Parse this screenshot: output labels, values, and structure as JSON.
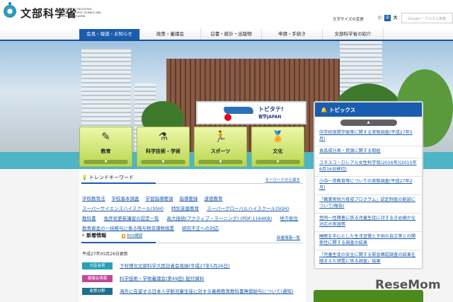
{
  "header": {
    "logo_text": "文部科学省",
    "logo_en": "MINISTRY OF EDUCATION, CULTURE, SPORTS, SCIENCE AND TECHNOLOGY-JAPAN",
    "font_size_label": "文字サイズの変更",
    "font_sizes": [
      "小",
      "中",
      "大"
    ],
    "search_placeholder": "Google™ カスタム検索"
  },
  "nav": [
    "会見・報道・お知らせ",
    "政策・審議会",
    "白書・統計・出版物",
    "申請・手続き",
    "文部科学省の紹介"
  ],
  "banner": {
    "title": "トビタテ!",
    "subtitle": "留学JAPAN"
  },
  "tiles": [
    {
      "label": "教育",
      "icon": "✎"
    },
    {
      "label": "科学技術・学術",
      "icon": "⚗"
    },
    {
      "label": "スポーツ",
      "icon": "🏃"
    },
    {
      "label": "文化",
      "icon": "🏅"
    }
  ],
  "trend": {
    "title": "トレンドキーワード",
    "more": "キーワードから探す",
    "keywords": [
      "学校教育法",
      "学校基本調査",
      "学習指導要領",
      "指導要録",
      "道徳教育",
      "スーパーサイエンスハイスクール(SSH)",
      "特別支援教育",
      "スーパーグローバルハイスクール(SGH)",
      "教科書",
      "免許状更新講習の認定一覧",
      "高大接続(アクティブ・ラーニング) (PDF:1164KB)",
      "地方創生",
      "教育資金の一括贈与に係る贈与税非課税措置",
      "研究不正への対応"
    ]
  },
  "news": {
    "title": "新着情報",
    "rss": "RSS講読",
    "more": "新着情報一覧",
    "updated": "平成27年05月26日更新",
    "items": [
      {
        "tag": "大臣会見",
        "color": "#2aa0b8",
        "text": "下村博文文部科学大臣記者会見録(平成27年5月26日)"
      },
      {
        "tag": "審議会情報",
        "color": "#c0489a",
        "text": "科学技術・学術審議会(第49回) 配付資料"
      },
      {
        "tag": "政策分野",
        "color": "#1f6f8b",
        "text": "海外に在留する日本人学齢児童生徒に対する義務教育教科書無償給与について(通知)"
      }
    ]
  },
  "topics": {
    "title": "トピックス",
    "items": [
      "中学校夜間学級等に関する実態調査(平成27年5月)",
      "食品成分表・資源に関する取組",
      "ユネスコ・ロレアル女性科学賞(2016年)(2015年6月16日締切)",
      "小中一貫教育等についての実態調査(平成27年2月)",
      "「職業実践力育成プログラム」認定制度の創設について(報告)",
      "性同一性障害に係る児童生徒に対するきめ細かな対応の実施等",
      "睡眠を中心とした生活習慣と子供の自立等との関係性に関する調査の結果",
      "「児童生徒の安全に関する緊急確認調査の結果を踏まえた措置に係る調査」結果"
    ]
  },
  "watermark": "ReseMom"
}
